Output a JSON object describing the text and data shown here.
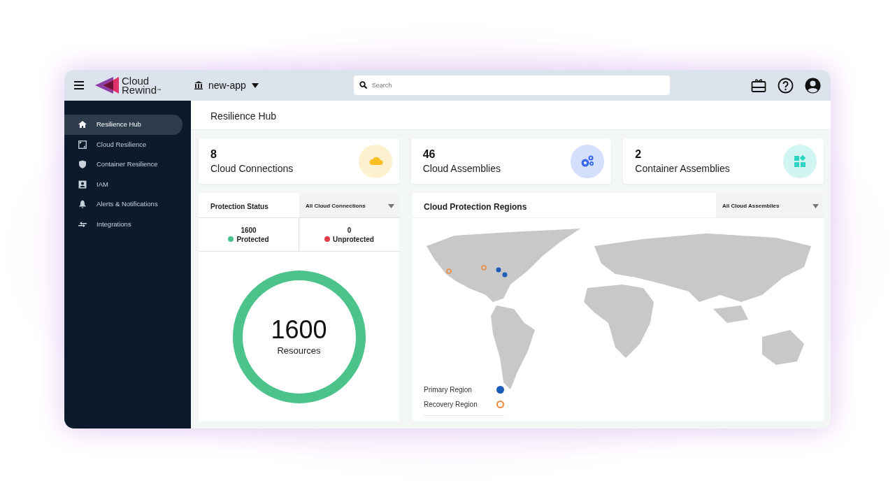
{
  "topbar": {
    "brand_line1": "Cloud",
    "brand_line2": "Rewind",
    "brand_mark": "™",
    "app_selector": "new-app",
    "search": {
      "placeholder": "Search"
    }
  },
  "sidebar": {
    "items": [
      {
        "label": "Resilience Hub",
        "selected": true
      },
      {
        "label": "Cloud Resilience",
        "selected": false
      },
      {
        "label": "Container Resilience",
        "selected": false
      },
      {
        "label": "IAM",
        "selected": false
      },
      {
        "label": "Alerts & Notifications",
        "selected": false
      },
      {
        "label": "Integrations",
        "selected": false
      }
    ]
  },
  "page_title": "Resilience Hub",
  "stats": [
    {
      "value": "8",
      "label": "Cloud Connections",
      "color": "#fbbf24"
    },
    {
      "value": "46",
      "label": "Cloud Assemblies",
      "color": "#3b6cf0"
    },
    {
      "value": "2",
      "label": "Container Assemblies",
      "color": "#2dd4bf"
    }
  ],
  "protection_status": {
    "title": "Protection Status",
    "filter": "All Cloud Connections",
    "counts": [
      {
        "value": "1600",
        "label": "Protected",
        "color": "#4cc38a"
      },
      {
        "value": "0",
        "label": "Unprotected",
        "color": "#e23d4b"
      }
    ],
    "ring": {
      "value": "1600",
      "label": "Resources",
      "level": 1
    }
  },
  "regions": {
    "title": "Cloud Protection Regions",
    "filter": "All Cloud Assemblies",
    "legend": [
      {
        "label": "Primary Region",
        "kind": "primary",
        "color": "#1c5bb8"
      },
      {
        "label": "Recovery Region",
        "kind": "recovery",
        "color": "#ef8a3c"
      }
    ]
  }
}
